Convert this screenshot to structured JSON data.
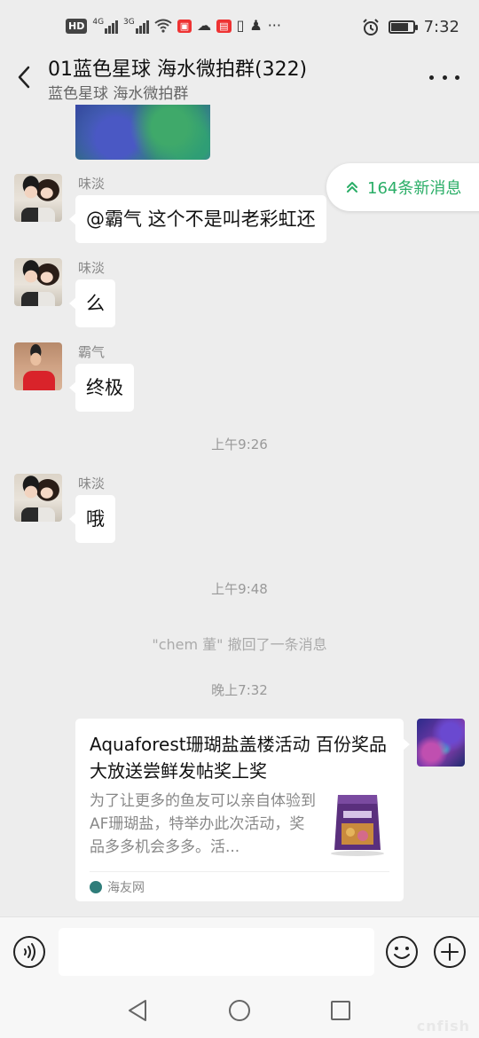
{
  "status_bar": {
    "hd_label": "HD",
    "net1": "4G",
    "net2": "3G",
    "time": "7:32",
    "battery_level": 0.8
  },
  "header": {
    "title": "01蓝色星球 海水微拍群(322)",
    "subtitle": "蓝色星球 海水微拍群"
  },
  "new_messages": {
    "label": "164条新消息",
    "accent": "#2aae67"
  },
  "messages": [
    {
      "sender": "味淡",
      "text": "@霸气  这个不是叫老彩虹还",
      "avatar": "couple-photo"
    },
    {
      "sender": "味淡",
      "text": "么",
      "avatar": "couple-photo"
    },
    {
      "sender": "霸气",
      "text": "终极",
      "avatar": "red-shirt-photo"
    },
    {
      "sender": "味淡",
      "text": "哦",
      "avatar": "couple-photo"
    }
  ],
  "timestamps": [
    "上午9:26",
    "上午9:48",
    "晚上7:32"
  ],
  "recall_notice": "\"chem 董\" 撤回了一条消息",
  "link_card": {
    "title": "Aquaforest珊瑚盐盖楼活动 百份奖品大放送尝鲜发帖奖上奖",
    "description": "为了让更多的鱼友可以亲自体验到AF珊瑚盐，特举办此次活动，奖品多多机会多多。活...",
    "source": "海友网"
  },
  "input": {
    "value": "",
    "placeholder": ""
  },
  "watermark": "cnfish"
}
